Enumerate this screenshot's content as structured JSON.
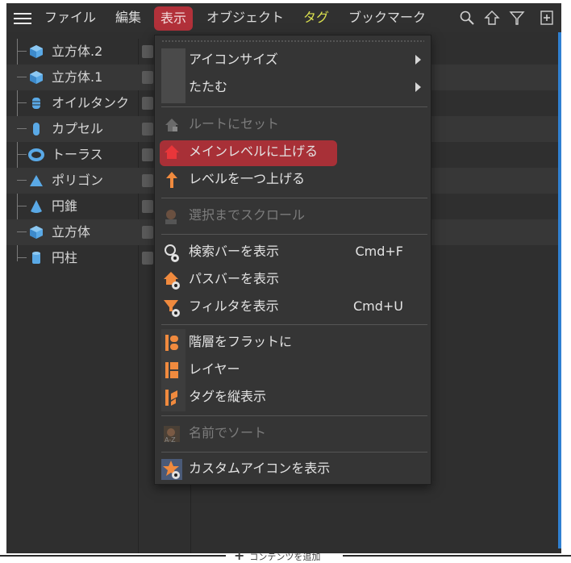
{
  "menubar": {
    "items": [
      {
        "label": "ファイル"
      },
      {
        "label": "編集"
      },
      {
        "label": "表示"
      },
      {
        "label": "オブジェクト"
      },
      {
        "label": "タグ"
      },
      {
        "label": "ブックマーク"
      }
    ],
    "icons": [
      "search-icon",
      "home-up-icon",
      "filter-icon",
      "new-window-icon"
    ]
  },
  "tree": {
    "objects": [
      {
        "label": "立方体.2",
        "icon": "cube-icon"
      },
      {
        "label": "立方体.1",
        "icon": "cube-icon"
      },
      {
        "label": "オイルタンク",
        "icon": "oil-tank-icon"
      },
      {
        "label": "カプセル",
        "icon": "capsule-icon"
      },
      {
        "label": "トーラス",
        "icon": "torus-icon"
      },
      {
        "label": "ポリゴン",
        "icon": "polygon-icon"
      },
      {
        "label": "円錐",
        "icon": "cone-icon"
      },
      {
        "label": "立方体",
        "icon": "cube-icon"
      },
      {
        "label": "円柱",
        "icon": "cylinder-icon"
      }
    ]
  },
  "dropdown": {
    "items": [
      {
        "label": "アイコンサイズ",
        "submenu": true
      },
      {
        "label": "たたむ",
        "submenu": true
      },
      {
        "label": "ルートにセット",
        "disabled": true,
        "icon": "set-root-icon"
      },
      {
        "label": "メインレベルに上げる",
        "highlighted": true,
        "icon": "main-level-icon"
      },
      {
        "label": "レベルを一つ上げる",
        "icon": "up-arrow-icon"
      },
      {
        "label": "選択までスクロール",
        "disabled": true,
        "icon": "scroll-to-selection-icon"
      },
      {
        "label": "検索バーを表示",
        "shortcut": "Cmd+F",
        "icon": "search-bar-icon"
      },
      {
        "label": "パスバーを表示",
        "icon": "path-bar-icon"
      },
      {
        "label": "フィルタを表示",
        "shortcut": "Cmd+U",
        "icon": "filter-show-icon"
      },
      {
        "label": "階層をフラットに",
        "icon": "flatten-hierarchy-icon"
      },
      {
        "label": "レイヤー",
        "icon": "layer-icon"
      },
      {
        "label": "タグを縦表示",
        "icon": "vertical-tags-icon"
      },
      {
        "label": "名前でソート",
        "disabled": true,
        "icon": "sort-by-name-icon"
      },
      {
        "label": "カスタムアイコンを表示",
        "icon": "custom-icon-icon"
      }
    ]
  },
  "footer": {
    "add_content": "コンテンツを追加"
  },
  "colors": {
    "accent": "#b2313a",
    "background": "#2f2f2f",
    "tag_label": "#d9df4f"
  }
}
